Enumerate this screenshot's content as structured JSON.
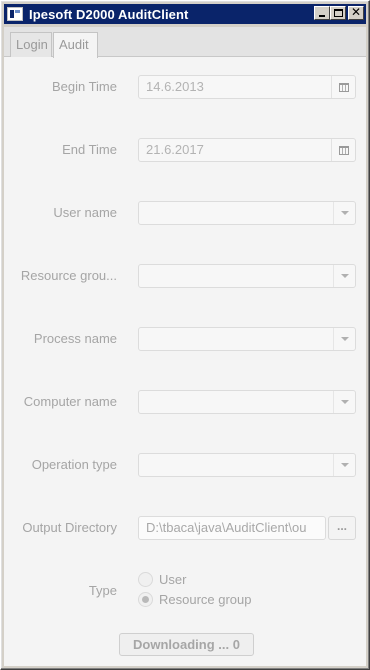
{
  "window": {
    "title": "Ipesoft D2000 AuditClient",
    "close_glyph": "✕"
  },
  "tabs": [
    {
      "label": "Login",
      "selected": false
    },
    {
      "label": "Audit",
      "selected": true
    }
  ],
  "form": {
    "begin_time": {
      "label": "Begin Time",
      "value": "14.6.2013"
    },
    "end_time": {
      "label": "End Time",
      "value": "21.6.2017"
    },
    "user_name": {
      "label": "User name",
      "value": ""
    },
    "resource_group": {
      "label": "Resource grou...",
      "value": ""
    },
    "process_name": {
      "label": "Process name",
      "value": ""
    },
    "computer_name": {
      "label": "Computer name",
      "value": ""
    },
    "operation_type": {
      "label": "Operation type",
      "value": ""
    },
    "output_directory": {
      "label": "Output Directory",
      "value": "D:\\tbaca\\java\\AuditClient\\ou",
      "browse_label": "..."
    },
    "type": {
      "label": "Type",
      "options": [
        {
          "label": "User",
          "selected": false
        },
        {
          "label": "Resource group",
          "selected": true
        }
      ]
    }
  },
  "download_button": {
    "label": "Downloading ... 0"
  },
  "colors": {
    "titlebar": "#0a246a",
    "disabled_text": "#a5a5a5",
    "background": "#f4f4f4"
  },
  "icons": {
    "calendar": "calendar-icon",
    "combo_arrow": "chevron-down-icon"
  }
}
